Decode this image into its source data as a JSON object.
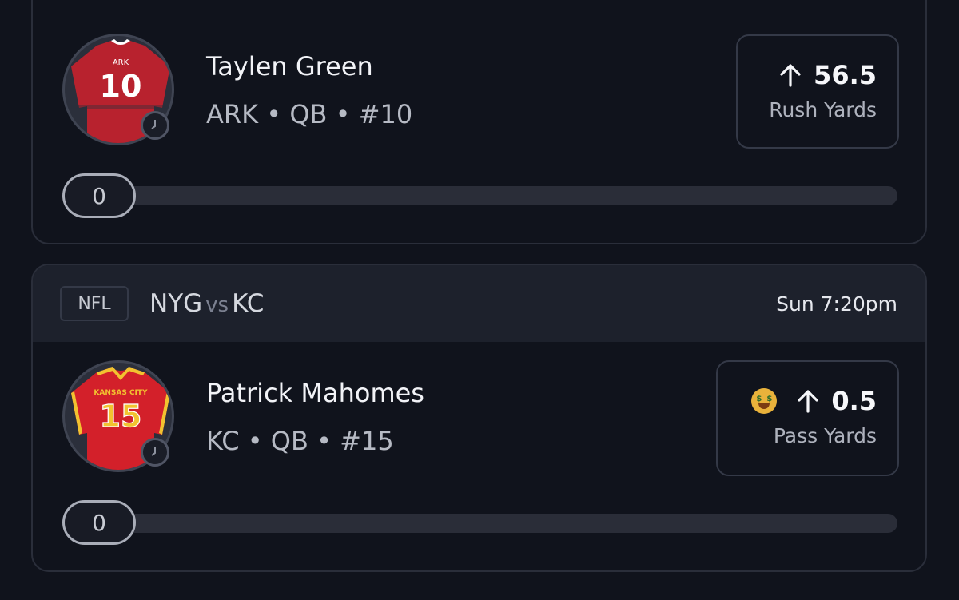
{
  "cards": [
    {
      "player": {
        "name": "Taylen Green",
        "meta": "ARK • QB • #10",
        "jersey_number": "10",
        "jersey_team": "ARK"
      },
      "pick": {
        "direction_icon": "arrow-up-icon",
        "line": "56.5",
        "stat": "Rush Yards"
      },
      "progress": {
        "value": "0",
        "fraction": 0
      }
    },
    {
      "header": {
        "league": "NFL",
        "home": "NYG",
        "vs": "vs",
        "away": "KC",
        "time": "Sun 7:20pm"
      },
      "player": {
        "name": "Patrick Mahomes",
        "meta": "KC • QB • #15",
        "jersey_number": "15",
        "jersey_team": "KANSAS CITY"
      },
      "pick": {
        "badge_icon": "money-mouth-face-icon",
        "direction_icon": "arrow-up-icon",
        "line": "0.5",
        "stat": "Pass Yards"
      },
      "progress": {
        "value": "0",
        "fraction": 0
      }
    }
  ],
  "colors": {
    "background": "#10131c",
    "header": "#1d212c",
    "ark_red": "#b8222e",
    "kc_red": "#d3202a",
    "kc_gold": "#f2c230"
  }
}
